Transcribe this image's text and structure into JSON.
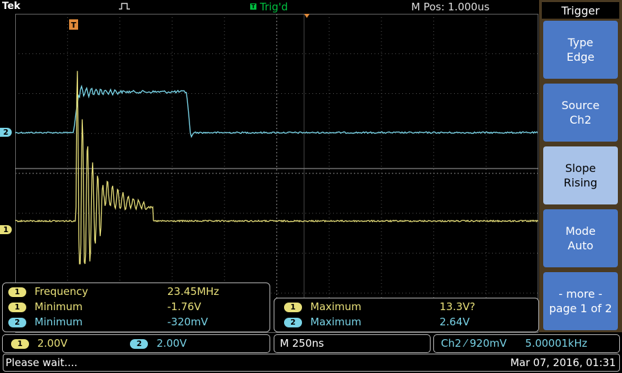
{
  "top": {
    "brand": "Tek",
    "trigger_status": "Trig'd",
    "horizontal_position": "M Pos: 1.000us",
    "icons": [
      "run-pulse-icon",
      "trigger-status-icon"
    ]
  },
  "markers": {
    "ch2": "2",
    "ch1": "1",
    "trigger": "T"
  },
  "colors": {
    "ch1": "#e8e07a",
    "ch2": "#79d3e6",
    "menu_bg": "#4a3a22",
    "menu_button": "#4b79c6",
    "trig": "#00c040"
  },
  "menu": {
    "title": "Trigger",
    "buttons": [
      {
        "line1": "Type",
        "line2": "Edge"
      },
      {
        "line1": "Source",
        "line2": "Ch2"
      },
      {
        "line1": "Slope",
        "line2": "Rising",
        "selected": true
      },
      {
        "line1": "Mode",
        "line2": "Auto"
      },
      {
        "line1": "- more -",
        "line2": "page 1 of 2"
      }
    ]
  },
  "measurements_left": [
    {
      "ch": "1",
      "label": "Frequency",
      "value": "23.45MHz"
    },
    {
      "ch": "1",
      "label": "Minimum",
      "value": "-1.76V"
    },
    {
      "ch": "2",
      "label": "Minimum",
      "value": "-320mV"
    }
  ],
  "measurements_right": [
    {
      "ch": "1",
      "label": "Maximum",
      "value": "13.3V?"
    },
    {
      "ch": "2",
      "label": "Maximum",
      "value": "2.64V"
    }
  ],
  "status": {
    "ch1_scale": "2.00V",
    "ch2_scale": "2.00V",
    "timebase": "M 250ns",
    "trigger_source": "Ch2",
    "trigger_level": "920mV",
    "trigger_freq": "5.00001kHz",
    "message": "Please wait....",
    "datetime": "Mar 07, 2016, 01:31"
  }
}
